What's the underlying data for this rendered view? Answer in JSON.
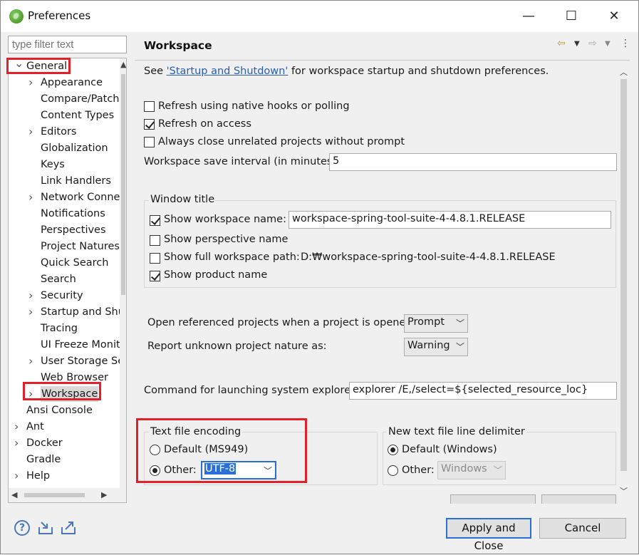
{
  "window": {
    "title": "Preferences",
    "minimize": "—",
    "maximize": "☐",
    "close": "✕"
  },
  "filter": {
    "placeholder": "type filter text"
  },
  "tree": {
    "items": [
      {
        "label": "General",
        "level": 0,
        "expander": "open"
      },
      {
        "label": "Appearance",
        "level": 1,
        "expander": "closed"
      },
      {
        "label": "Compare/Patch",
        "level": 1,
        "expander": "none"
      },
      {
        "label": "Content Types",
        "level": 1,
        "expander": "none"
      },
      {
        "label": "Editors",
        "level": 1,
        "expander": "closed"
      },
      {
        "label": "Globalization",
        "level": 1,
        "expander": "none"
      },
      {
        "label": "Keys",
        "level": 1,
        "expander": "none"
      },
      {
        "label": "Link Handlers",
        "level": 1,
        "expander": "none"
      },
      {
        "label": "Network Connections",
        "level": 1,
        "expander": "closed"
      },
      {
        "label": "Notifications",
        "level": 1,
        "expander": "none"
      },
      {
        "label": "Perspectives",
        "level": 1,
        "expander": "none"
      },
      {
        "label": "Project Natures",
        "level": 1,
        "expander": "none"
      },
      {
        "label": "Quick Search",
        "level": 1,
        "expander": "none"
      },
      {
        "label": "Search",
        "level": 1,
        "expander": "none"
      },
      {
        "label": "Security",
        "level": 1,
        "expander": "closed"
      },
      {
        "label": "Startup and Shutdown",
        "level": 1,
        "expander": "closed"
      },
      {
        "label": "Tracing",
        "level": 1,
        "expander": "none"
      },
      {
        "label": "UI Freeze Monitoring",
        "level": 1,
        "expander": "none"
      },
      {
        "label": "User Storage Service",
        "level": 1,
        "expander": "closed"
      },
      {
        "label": "Web Browser",
        "level": 1,
        "expander": "none"
      },
      {
        "label": "Workspace",
        "level": 1,
        "expander": "closed",
        "selected": true
      },
      {
        "label": "Ansi Console",
        "level": 0,
        "expander": "none"
      },
      {
        "label": "Ant",
        "level": 0,
        "expander": "closed"
      },
      {
        "label": "Docker",
        "level": 0,
        "expander": "closed"
      },
      {
        "label": "Gradle",
        "level": 0,
        "expander": "none"
      },
      {
        "label": "Help",
        "level": 0,
        "expander": "closed"
      }
    ]
  },
  "panel": {
    "title": "Workspace",
    "intro_prefix": "See ",
    "intro_link": "'Startup and Shutdown'",
    "intro_suffix": " for workspace startup and shutdown preferences.",
    "refresh_native": {
      "label": "Refresh using native hooks or polling",
      "checked": false
    },
    "refresh_access": {
      "label": "Refresh on access",
      "checked": true
    },
    "always_close": {
      "label": "Always close unrelated projects without prompt",
      "checked": false
    },
    "save_interval": {
      "label": "Workspace save interval (in minutes):",
      "value": "5"
    },
    "window_title": {
      "legend": "Window title",
      "show_ws_name": {
        "label": "Show workspace name:",
        "checked": true,
        "value": "workspace-spring-tool-suite-4-4.8.1.RELEASE"
      },
      "show_perspective": {
        "label": "Show perspective name",
        "checked": false
      },
      "show_full_path": {
        "label": "Show full workspace path:",
        "checked": false,
        "value": "D:₩workspace-spring-tool-suite-4-4.8.1.RELEASE"
      },
      "show_product": {
        "label": "Show product name",
        "checked": true
      }
    },
    "open_ref": {
      "label": "Open referenced projects when a project is opened:",
      "value": "Prompt"
    },
    "report_nature": {
      "label": "Report unknown project nature as:",
      "value": "Warning"
    },
    "explorer_cmd": {
      "label": "Command for launching system explorer:",
      "value": "explorer /E,/select=${selected_resource_loc}"
    },
    "encoding": {
      "legend": "Text file encoding",
      "default_label": "Default (MS949)",
      "other_label": "Other:",
      "other_value": "UTF-8",
      "selected": "other"
    },
    "line_delim": {
      "legend": "New text file line delimiter",
      "default_label": "Default (Windows)",
      "other_label": "Other:",
      "other_value": "Windows",
      "selected": "default"
    }
  },
  "footer": {
    "apply_close": "Apply and Close",
    "cancel": "Cancel",
    "help_icon": "?"
  },
  "colors": {
    "highlight": "#e0202a",
    "selection": "#2a6fd6",
    "link": "#2a5db0"
  }
}
